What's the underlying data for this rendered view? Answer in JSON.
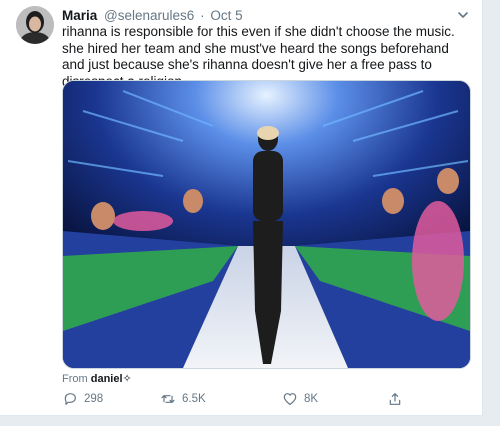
{
  "tweet": {
    "author_name": "Maria",
    "handle": "@selenarules6",
    "separator": "·",
    "date": "Oct 5",
    "text": "rihanna is responsible for this even if she didn't choose the music. she hired her team and she must've heard the songs beforehand and just because she's rihanna doesn't give her a free pass to disrespect a religion",
    "media_source_prefix": "From",
    "media_source_name": "daniel✧",
    "replies": "298",
    "retweets": "6.5K",
    "likes": "8K"
  },
  "colors": {
    "accent": "#1da1f2",
    "text_primary": "#14171a",
    "text_secondary": "#657786",
    "background": "#e6ecf0"
  },
  "icons": [
    "caret-down-icon",
    "reply-icon",
    "retweet-icon",
    "like-icon",
    "share-icon"
  ]
}
